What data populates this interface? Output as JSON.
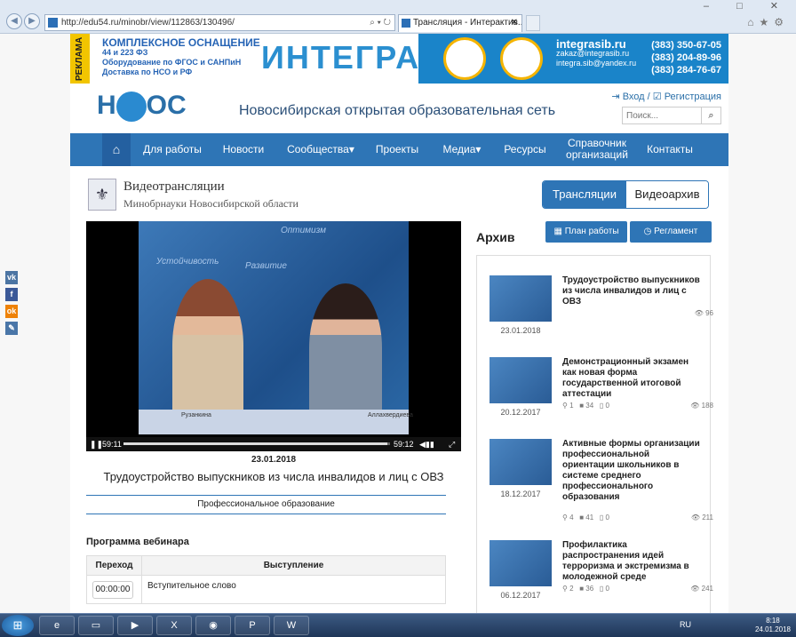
{
  "browser": {
    "url": "http://edu54.ru/minobr/view/112863/130496/",
    "tab_title": "Трансляция - Интерактив...",
    "window_controls": "–  □  ✕"
  },
  "banner": {
    "reklama": "РЕКЛАМА",
    "line1": "КОМПЛЕКСНОЕ ОСНАЩЕНИЕ",
    "line2": "44 и 223 ФЗ",
    "line3": "Оборудование по ФГОС и САНПиН",
    "line4": "Доставка по НСО и РФ",
    "brand": "ИНТЕГРАS",
    "site": "integrasib.ru",
    "email1": "zakaz@integrasib.ru",
    "email2": "integra.sib@yandex.ru",
    "phone1": "(383) 350-67-05",
    "phone2": "(383) 204-89-96",
    "phone3": "(383) 284-76-67"
  },
  "header": {
    "logo_left": "Н",
    "logo_right": "ОС",
    "title": "Новосибирская открытая образовательная сеть",
    "login": "Вход",
    "register": "Регистрация",
    "search_placeholder": "Поиск..."
  },
  "menu": [
    "Для работы",
    "Новости",
    "Сообщества▾",
    "Проекты",
    "Медиа▾",
    "Ресурсы",
    "Справочник организаций",
    "Контакты"
  ],
  "section": {
    "title": "Видеотрансляции",
    "subtitle": "Минобрнауки Новосибирской области",
    "tab_live": "Трансляции",
    "tab_archive": "Видеоархив"
  },
  "player": {
    "time_current": "59:11",
    "time_total": "59:12",
    "progress": 0.99,
    "overlay_words": [
      "Устойчивость",
      "Развитие",
      "Оптимизм"
    ],
    "caption_left": "Рузанкина",
    "caption_right": "Аллахвердиева"
  },
  "video": {
    "date": "23.01.2018",
    "title": "Трудоустройство выпускников из числа инвалидов и лиц с ОВЗ",
    "category": "Профессиональное образование"
  },
  "program": {
    "heading": "Программа вебинара",
    "col_time": "Переход",
    "col_talk": "Выступление",
    "rows": [
      {
        "time": "00:00:00",
        "talk": "Вступительное слово"
      }
    ]
  },
  "archive": {
    "heading": "Архив",
    "btn_plan": "План работы",
    "btn_rules": "Регламент",
    "items": [
      {
        "title": "Трудоустройство выпускников из числа инвалидов и лиц с ОВЗ",
        "date": "23.01.2018",
        "views": "96",
        "pins": "",
        "videos": "",
        "comments": ""
      },
      {
        "title": "Демонстрационный экзамен как новая форма государственной итоговой аттестации",
        "date": "20.12.2017",
        "views": "188",
        "pins": "1",
        "videos": "34",
        "comments": "0"
      },
      {
        "title": "Активные формы организации профессиональной ориентации школьников в системе среднего профессионального образования",
        "date": "18.12.2017",
        "views": "211",
        "pins": "4",
        "videos": "41",
        "comments": "0"
      },
      {
        "title": "Профилактика распространения идей терроризма и экстремизма в молодежной среде",
        "date": "06.12.2017",
        "views": "241",
        "pins": "2",
        "videos": "36",
        "comments": "0"
      }
    ]
  },
  "social": [
    "vk",
    "f",
    "ok",
    "✎"
  ],
  "taskbar": {
    "lang": "RU",
    "time": "8:18",
    "date": "24.01.2018"
  }
}
